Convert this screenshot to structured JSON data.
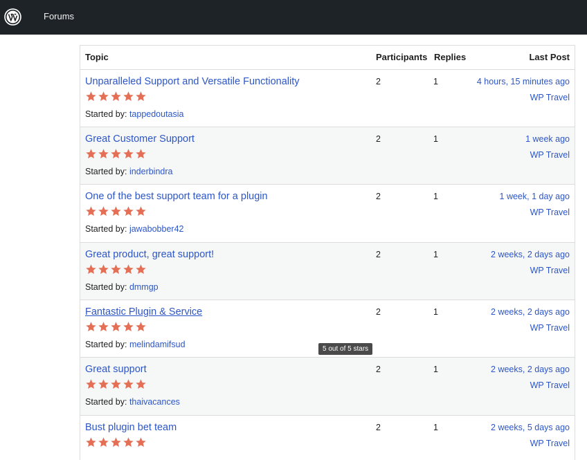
{
  "nav": {
    "logo_icon": "wordpress-logo-icon",
    "forums_label": "Forums"
  },
  "table": {
    "headers": {
      "topic": "Topic",
      "participants": "Participants",
      "replies": "Replies",
      "last_post": "Last Post"
    },
    "started_prefix": "Started by:",
    "rows": [
      {
        "title": "Unparalleled Support and Versatile Functionality",
        "rating": 5,
        "author": "tappedoutasia",
        "participants": "2",
        "replies": "1",
        "last_time": "4 hours, 15 minutes ago",
        "last_author": "WP Travel"
      },
      {
        "title": "Great Customer Support",
        "rating": 5,
        "author": "inderbindra",
        "participants": "2",
        "replies": "1",
        "last_time": "1 week ago",
        "last_author": "WP Travel"
      },
      {
        "title": "One of the best support team for a plugin",
        "rating": 5,
        "author": "jawabobber42",
        "participants": "2",
        "replies": "1",
        "last_time": "1 week, 1 day ago",
        "last_author": "WP Travel"
      },
      {
        "title": "Great product, great support!",
        "rating": 5,
        "author": "dmmgp",
        "participants": "2",
        "replies": "1",
        "last_time": "2 weeks, 2 days ago",
        "last_author": "WP Travel"
      },
      {
        "title": "Fantastic Plugin & Service",
        "rating": 5,
        "author": "melindamifsud",
        "participants": "2",
        "replies": "1",
        "last_time": "2 weeks, 2 days ago",
        "last_author": "WP Travel"
      },
      {
        "title": "Great support",
        "rating": 5,
        "author": "thaivacances",
        "participants": "2",
        "replies": "1",
        "last_time": "2 weeks, 2 days ago",
        "last_author": "WP Travel"
      },
      {
        "title": "Bust plugin bet team",
        "rating": 5,
        "author": "",
        "participants": "2",
        "replies": "1",
        "last_time": "2 weeks, 5 days ago",
        "last_author": "WP Travel"
      }
    ]
  },
  "tooltip": {
    "text": "5 out of 5 stars"
  },
  "colors": {
    "topbar": "#1d2327",
    "link": "#2c56c8",
    "star": "#e26f56",
    "row_alt": "#f6f7f7",
    "border": "#dcdcde"
  }
}
